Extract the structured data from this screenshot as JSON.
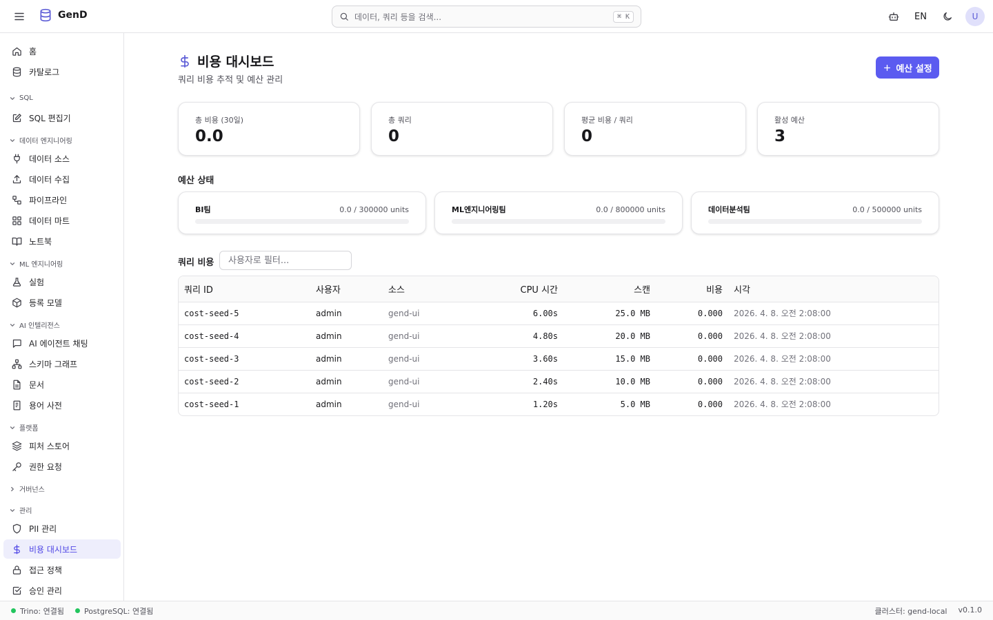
{
  "header": {
    "brand": "GenD",
    "search_placeholder": "데이터, 쿼리 등을 검색...",
    "shortcut": "⌘ K",
    "lang": "EN",
    "avatar": "U"
  },
  "sidebar": {
    "items": [
      {
        "label": "홈",
        "icon": "home-icon"
      },
      {
        "label": "카탈로그",
        "icon": "database-icon"
      },
      {
        "label": "SQL 편집기",
        "icon": "edit-icon"
      },
      {
        "label": "데이터 소스",
        "icon": "plug-icon"
      },
      {
        "label": "데이터 수집",
        "icon": "upload-icon"
      },
      {
        "label": "파이프라인",
        "icon": "workflow-icon"
      },
      {
        "label": "데이터 마트",
        "icon": "grid-icon"
      },
      {
        "label": "노트북",
        "icon": "book-icon"
      },
      {
        "label": "실험",
        "icon": "flask-icon"
      },
      {
        "label": "등록 모델",
        "icon": "box-icon"
      },
      {
        "label": "AI 에이전트 채팅",
        "icon": "chat-icon"
      },
      {
        "label": "스키마 그래프",
        "icon": "network-icon"
      },
      {
        "label": "문서",
        "icon": "document-icon"
      },
      {
        "label": "용어 사전",
        "icon": "glossary-icon"
      },
      {
        "label": "피처 스토어",
        "icon": "layers-icon"
      },
      {
        "label": "권한 요청",
        "icon": "key-icon"
      },
      {
        "label": "PII 관리",
        "icon": "shield-icon"
      },
      {
        "label": "비용 대시보드",
        "icon": "dollar-icon"
      },
      {
        "label": "접근 정책",
        "icon": "lock-icon"
      },
      {
        "label": "승인 관리",
        "icon": "check-square-icon"
      }
    ],
    "sections": [
      "SQL",
      "데이터 엔지니어링",
      "ML 엔지니어링",
      "AI 인텔리전스",
      "플랫폼",
      "거버넌스",
      "관리"
    ]
  },
  "page": {
    "title": "비용 대시보드",
    "subtitle": "쿼리 비용 추적 및 예산 관리",
    "budget_button": "예산 설정"
  },
  "stats": [
    {
      "label": "총 비용 (30일)",
      "value": "0.0"
    },
    {
      "label": "총 쿼리",
      "value": "0"
    },
    {
      "label": "평균 비용 / 쿼리",
      "value": "0"
    },
    {
      "label": "활성 예산",
      "value": "3"
    }
  ],
  "budget_section": {
    "title": "예산 상태",
    "budgets": [
      {
        "name": "BI팀",
        "usage": "0.0 / 300000 units",
        "fraction": 0
      },
      {
        "name": "ML엔지니어링팀",
        "usage": "0.0 / 800000 units",
        "fraction": 0
      },
      {
        "name": "데이터분석팀",
        "usage": "0.0 / 500000 units",
        "fraction": 0
      }
    ]
  },
  "query_section": {
    "title": "쿼리 비용",
    "filter_placeholder": "사용자로 필터...",
    "columns": [
      "쿼리 ID",
      "사용자",
      "소스",
      "CPU 시간",
      "스캔",
      "비용",
      "시각"
    ],
    "rows": [
      {
        "id": "cost-seed-5",
        "user": "admin",
        "source": "gend-ui",
        "cpu": "6.00s",
        "scan": "25.0 MB",
        "cost": "0.000",
        "time": "2026. 4. 8. 오전 2:08:00"
      },
      {
        "id": "cost-seed-4",
        "user": "admin",
        "source": "gend-ui",
        "cpu": "4.80s",
        "scan": "20.0 MB",
        "cost": "0.000",
        "time": "2026. 4. 8. 오전 2:08:00"
      },
      {
        "id": "cost-seed-3",
        "user": "admin",
        "source": "gend-ui",
        "cpu": "3.60s",
        "scan": "15.0 MB",
        "cost": "0.000",
        "time": "2026. 4. 8. 오전 2:08:00"
      },
      {
        "id": "cost-seed-2",
        "user": "admin",
        "source": "gend-ui",
        "cpu": "2.40s",
        "scan": "10.0 MB",
        "cost": "0.000",
        "time": "2026. 4. 8. 오전 2:08:00"
      },
      {
        "id": "cost-seed-1",
        "user": "admin",
        "source": "gend-ui",
        "cpu": "1.20s",
        "scan": "5.0 MB",
        "cost": "0.000",
        "time": "2026. 4. 8. 오전 2:08:00"
      }
    ]
  },
  "footer": {
    "trino": "Trino: 연결됨",
    "postgres": "PostgreSQL: 연결됨",
    "cluster": "클러스터: gend-local",
    "version": "v0.1.0"
  },
  "colors": {
    "accent": "#5b5bf0",
    "active_bg": "#eeeefc",
    "status_ok": "#22c55e"
  }
}
